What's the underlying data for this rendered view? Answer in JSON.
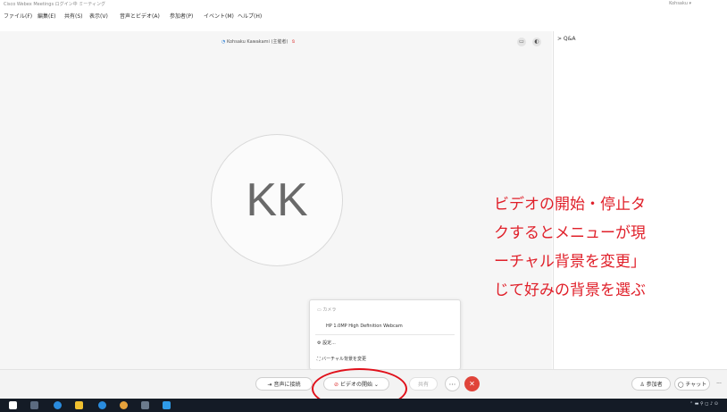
{
  "window": {
    "title": "Cisco Webex Meetings  ログイン中  ミーティング",
    "user": "Kohsaku ▾"
  },
  "menubar": [
    "ファイル(F)",
    "編集(E)",
    "共有(S)",
    "表示(V)",
    "音声とビデオ(A)",
    "参加者(P)",
    "イベント(M)",
    "ヘルプ(H)"
  ],
  "stage": {
    "participant_name": "Kohsaku Kawakami (主催者)",
    "avatar_initials": "KK"
  },
  "panel": {
    "title": "> Q&A"
  },
  "annotation": {
    "lines": [
      "ビデオの開始・停止タ",
      "クするとメニューが現",
      "ーチャル背景を変更」",
      "じて好みの背景を選ぶ"
    ]
  },
  "video_menu": {
    "camera_header": "カメラ",
    "camera_option": "HP 1.0MP High Definition Webcam",
    "settings": "設定...",
    "virtual_background": "バーチャル背景を変更"
  },
  "toolbar": {
    "connect_audio": "音声に接続",
    "start_video": "ビデオの開始",
    "share": "共有",
    "more": "···",
    "participants": "参加者",
    "chat": "チャット",
    "overflow": "···"
  },
  "colors": {
    "annotation": "#e0202a",
    "end_button": "#e0443a"
  }
}
